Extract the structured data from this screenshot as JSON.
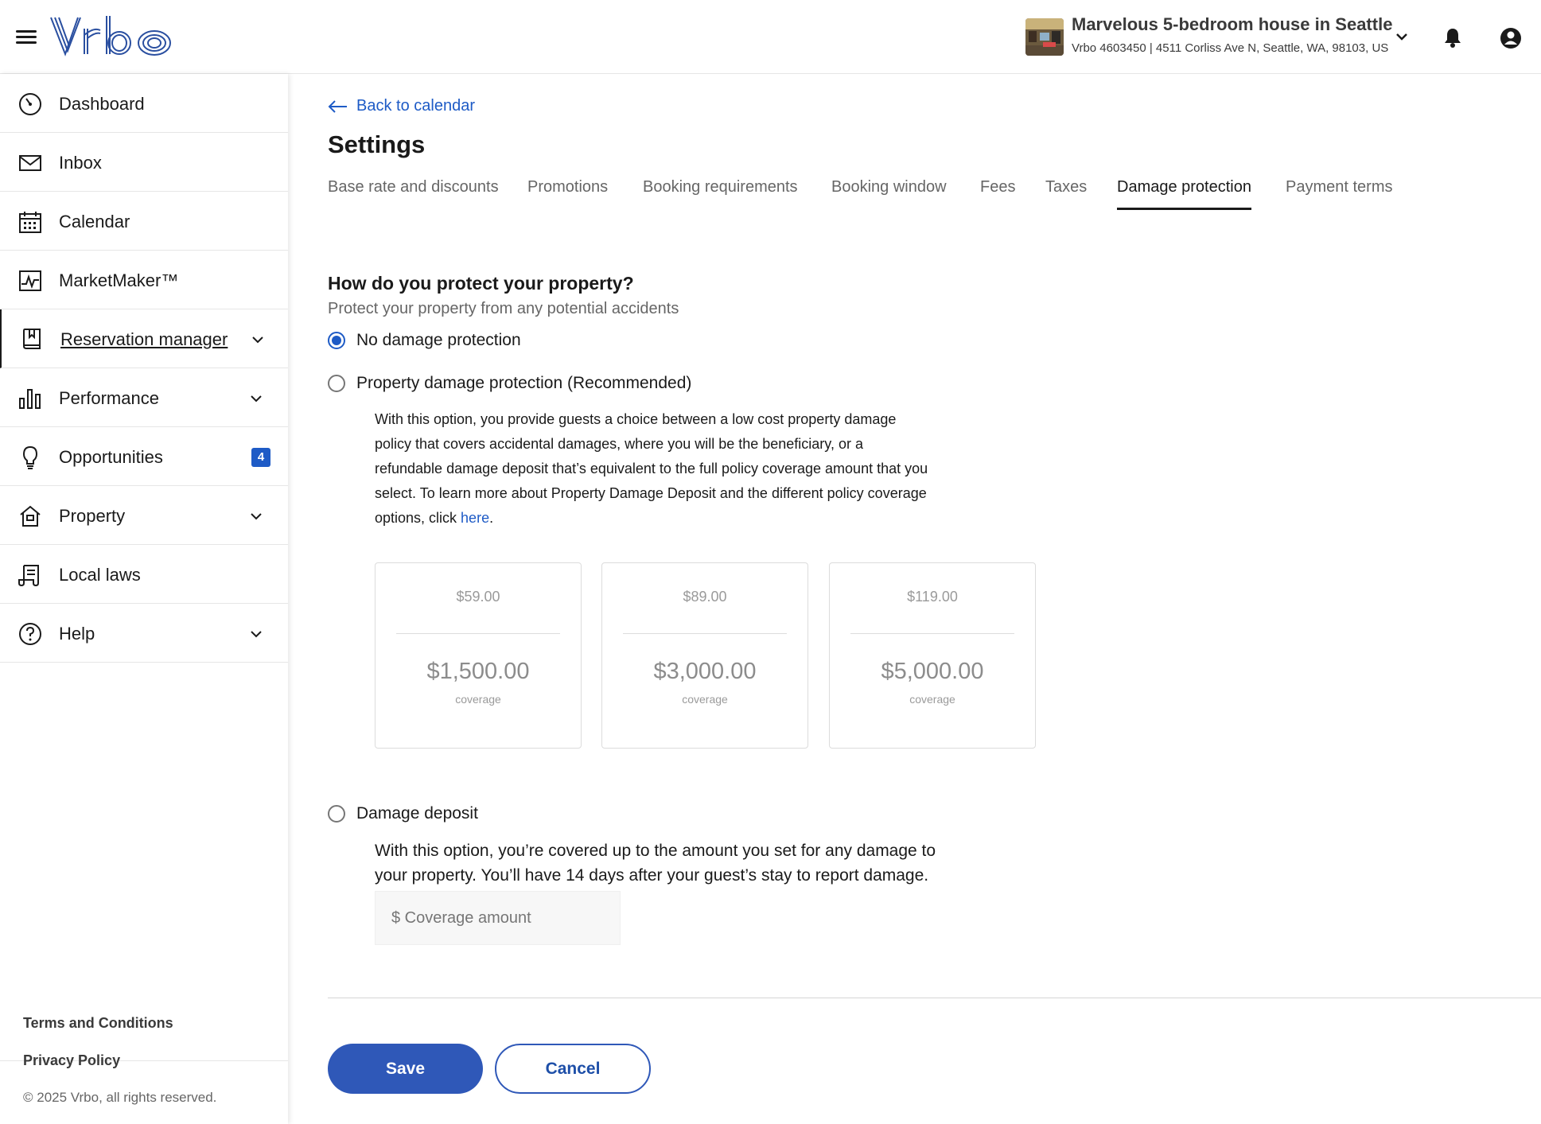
{
  "header": {
    "logo_text": "Vrbo",
    "property_title": "Marvelous 5-bedroom house in Seattle",
    "property_subtitle": "Vrbo 4603450 | 4511 Corliss Ave N, Seattle, WA, 98103, US"
  },
  "sidebar": {
    "items": [
      {
        "label": "Dashboard",
        "icon": "dashboard-icon"
      },
      {
        "label": "Inbox",
        "icon": "envelope-icon"
      },
      {
        "label": "Calendar",
        "icon": "calendar-icon"
      },
      {
        "label": "MarketMaker™",
        "icon": "line-chart-icon"
      },
      {
        "label": "Reservation manager",
        "icon": "book-icon"
      },
      {
        "label": "Performance",
        "icon": "bar-chart-icon"
      },
      {
        "label": "Opportunities",
        "icon": "lightbulb-icon",
        "badge": "4"
      },
      {
        "label": "Property",
        "icon": "house-icon"
      },
      {
        "label": "Local laws",
        "icon": "scroll-icon"
      },
      {
        "label": "Help",
        "icon": "question-icon"
      }
    ],
    "footer": {
      "terms": "Terms and Conditions",
      "privacy": "Privacy Policy",
      "copyright": "© 2025 Vrbo, all rights reserved."
    }
  },
  "main": {
    "back_label": "Back to calendar",
    "title": "Settings",
    "tabs": [
      {
        "label": "Base rate and discounts"
      },
      {
        "label": "Promotions"
      },
      {
        "label": "Booking requirements"
      },
      {
        "label": "Booking window"
      },
      {
        "label": "Fees"
      },
      {
        "label": "Taxes"
      },
      {
        "label": "Damage protection",
        "active": true
      },
      {
        "label": "Payment terms"
      }
    ],
    "section_heading": "How do you protect your property?",
    "section_subheading": "Protect your property from any potential accidents",
    "options": {
      "none": {
        "label": "No damage protection",
        "selected": true
      },
      "pdp": {
        "label": "Property damage protection (Recommended)",
        "desc_text": "With this option, you provide guests a choice between a low cost property damage policy that covers accidental damages, where you will be the beneficiary, or a refundable damage deposit that’s equivalent to the full policy coverage amount that you select. To learn more about Property Damage Deposit and the different policy coverage options, click ",
        "desc_link": "here",
        "desc_end": "."
      },
      "deposit": {
        "label": "Damage deposit",
        "desc": "With this option, you’re covered up to the amount you set for any damage to your property. You’ll have 14 days after your guest’s stay to report damage.",
        "input_placeholder": "$ Coverage amount"
      }
    },
    "plans": [
      {
        "price": "$59.00",
        "coverage": "$1,500.00",
        "coverage_label": "coverage"
      },
      {
        "price": "$89.00",
        "coverage": "$3,000.00",
        "coverage_label": "coverage"
      },
      {
        "price": "$119.00",
        "coverage": "$5,000.00",
        "coverage_label": "coverage"
      }
    ],
    "save_label": "Save",
    "cancel_label": "Cancel"
  },
  "colors": {
    "accent": "#1e5bc6",
    "save_button": "#2f58b8"
  }
}
